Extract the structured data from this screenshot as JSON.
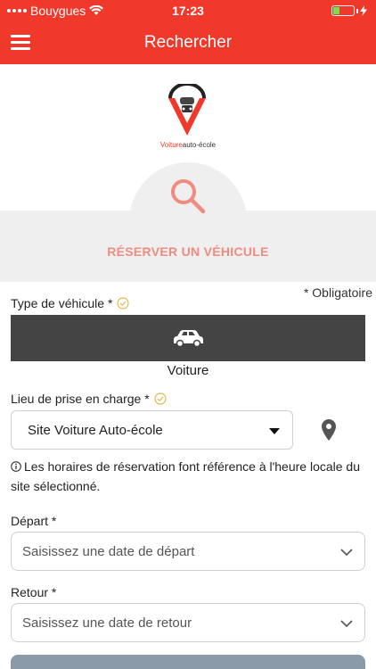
{
  "status_bar": {
    "carrier": "Bouygues",
    "time": "17:23",
    "battery_level": 0.3
  },
  "nav": {
    "title": "Rechercher"
  },
  "logo": {
    "brand_part1": "Voiture",
    "brand_part2": "auto-école"
  },
  "hero": {
    "reserve_title": "RÉSERVER UN VÉHICULE"
  },
  "form": {
    "required_note": "* Obligatoire",
    "vehicle_type_label": "Type de véhicule *",
    "vehicle_option": "Voiture",
    "pickup_label": "Lieu de prise en charge *",
    "pickup_value": "Site Voiture Auto-école",
    "info_text": "Les horaires de réservation font référence à l'heure locale du site sélectionné.",
    "departure_label": "Départ *",
    "departure_placeholder": "Saisissez une date de départ",
    "return_label": "Retour *",
    "return_placeholder": "Saisissez une date de retour"
  },
  "colors": {
    "brand": "#f0392b",
    "accent_text": "#f08c7f",
    "tile": "#444444",
    "check": "#e8b54a"
  }
}
